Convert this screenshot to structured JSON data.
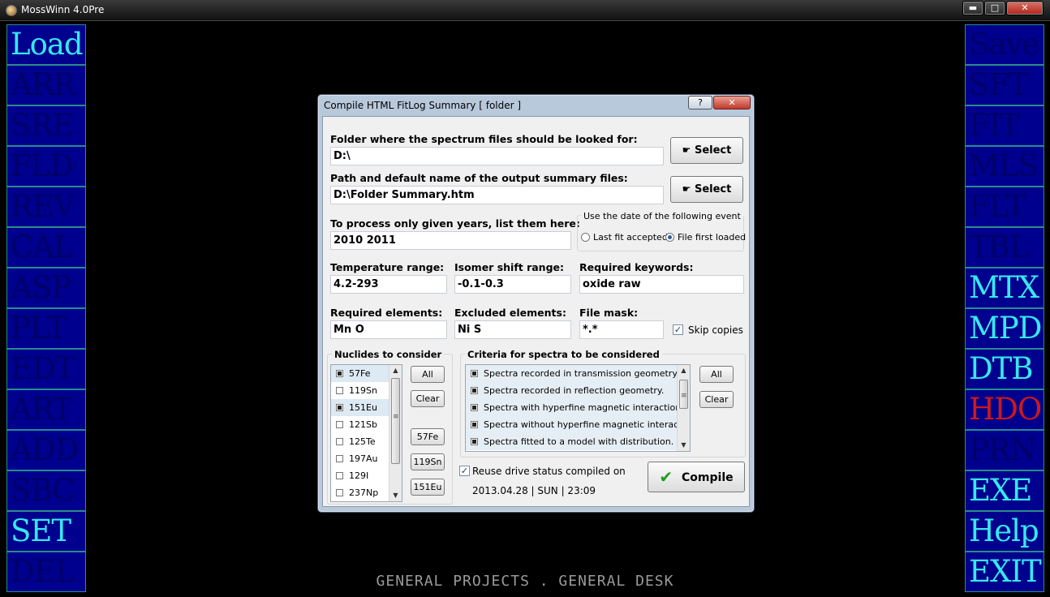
{
  "window": {
    "title": "MossWinn 4.0Pre",
    "min": "▬",
    "max": "□",
    "close": "✕"
  },
  "left_menu": [
    {
      "label": "Load",
      "state": "active"
    },
    {
      "label": "ARR",
      "state": "dim"
    },
    {
      "label": "SRE",
      "state": "dim"
    },
    {
      "label": "FLD",
      "state": "dim"
    },
    {
      "label": "REV",
      "state": "dim"
    },
    {
      "label": "CAL",
      "state": "dim"
    },
    {
      "label": "ASP",
      "state": "dim"
    },
    {
      "label": "PLT",
      "state": "dim"
    },
    {
      "label": "EDT",
      "state": "dim"
    },
    {
      "label": "ART",
      "state": "dim"
    },
    {
      "label": "ADD",
      "state": "dim"
    },
    {
      "label": "SBC",
      "state": "dim"
    },
    {
      "label": "SET",
      "state": "active"
    },
    {
      "label": "DEL",
      "state": "dim"
    }
  ],
  "right_menu": [
    {
      "label": "Save",
      "state": "dim"
    },
    {
      "label": "SFT",
      "state": "dim"
    },
    {
      "label": "FIT",
      "state": "dim"
    },
    {
      "label": "MLS",
      "state": "dim"
    },
    {
      "label": "FLT",
      "state": "dim"
    },
    {
      "label": "TBL",
      "state": "dim"
    },
    {
      "label": "MTX",
      "state": "active"
    },
    {
      "label": "MPD",
      "state": "active"
    },
    {
      "label": "DTB",
      "state": "active"
    },
    {
      "label": "HDO",
      "state": "red"
    },
    {
      "label": "PRN",
      "state": "dim"
    },
    {
      "label": "EXE",
      "state": "active"
    },
    {
      "label": "Help",
      "state": "active"
    },
    {
      "label": "EXIT",
      "state": "active"
    }
  ],
  "status_text": "GENERAL PROJECTS . GENERAL DESK",
  "dialog": {
    "title": "Compile HTML FitLog Summary [ folder ]",
    "help": "?",
    "close": "✕",
    "folder_label": "Folder where the spectrum files should be looked for:",
    "folder_value": "D:\\",
    "output_label": "Path and default name of the output summary files:",
    "output_value": "D:\\Folder Summary.htm",
    "select_label": "Select",
    "years_label": "To process only given years, list them here:",
    "years_value": "2010 2011",
    "date_group_title": "Use the date of the following event",
    "radio_last_fit": "Last fit accepted",
    "radio_first_loaded": "File first loaded",
    "temp_label": "Temperature range:",
    "temp_value": "4.2-293",
    "isomer_label": "Isomer shift range:",
    "isomer_value": "-0.1-0.3",
    "keywords_label": "Required keywords:",
    "keywords_value": "oxide raw",
    "req_elements_label": "Required elements:",
    "req_elements_value": "Mn O",
    "exc_elements_label": "Excluded elements:",
    "exc_elements_value": "Ni S",
    "mask_label": "File mask:",
    "mask_value": "*.*",
    "skip_copies_label": "Skip copies",
    "nuclides_title": "Nuclides to consider",
    "nuclides": [
      {
        "label": "57Fe",
        "checked": true
      },
      {
        "label": "119Sn",
        "checked": false
      },
      {
        "label": "151Eu",
        "checked": true
      },
      {
        "label": "121Sb",
        "checked": false
      },
      {
        "label": "125Te",
        "checked": false
      },
      {
        "label": "197Au",
        "checked": false
      },
      {
        "label": "129I",
        "checked": false
      },
      {
        "label": "237Np",
        "checked": false
      }
    ],
    "nuc_all": "All",
    "nuc_clear": "Clear",
    "nuc_quick": [
      "57Fe",
      "119Sn",
      "151Eu"
    ],
    "criteria_title": "Criteria for spectra to be considered",
    "criteria": [
      "Spectra recorded in transmission geometry.",
      "Spectra recorded in reflection geometry.",
      "Spectra with hyperfine magnetic interaction.",
      "Spectra without hyperfine magnetic interaction.",
      "Spectra fitted to a model with distribution."
    ],
    "crit_all": "All",
    "crit_clear": "Clear",
    "reuse_label": "Reuse drive status compiled on",
    "reuse_date": "2013.04.28  |  SUN  |  23:09",
    "compile_label": "Compile"
  }
}
